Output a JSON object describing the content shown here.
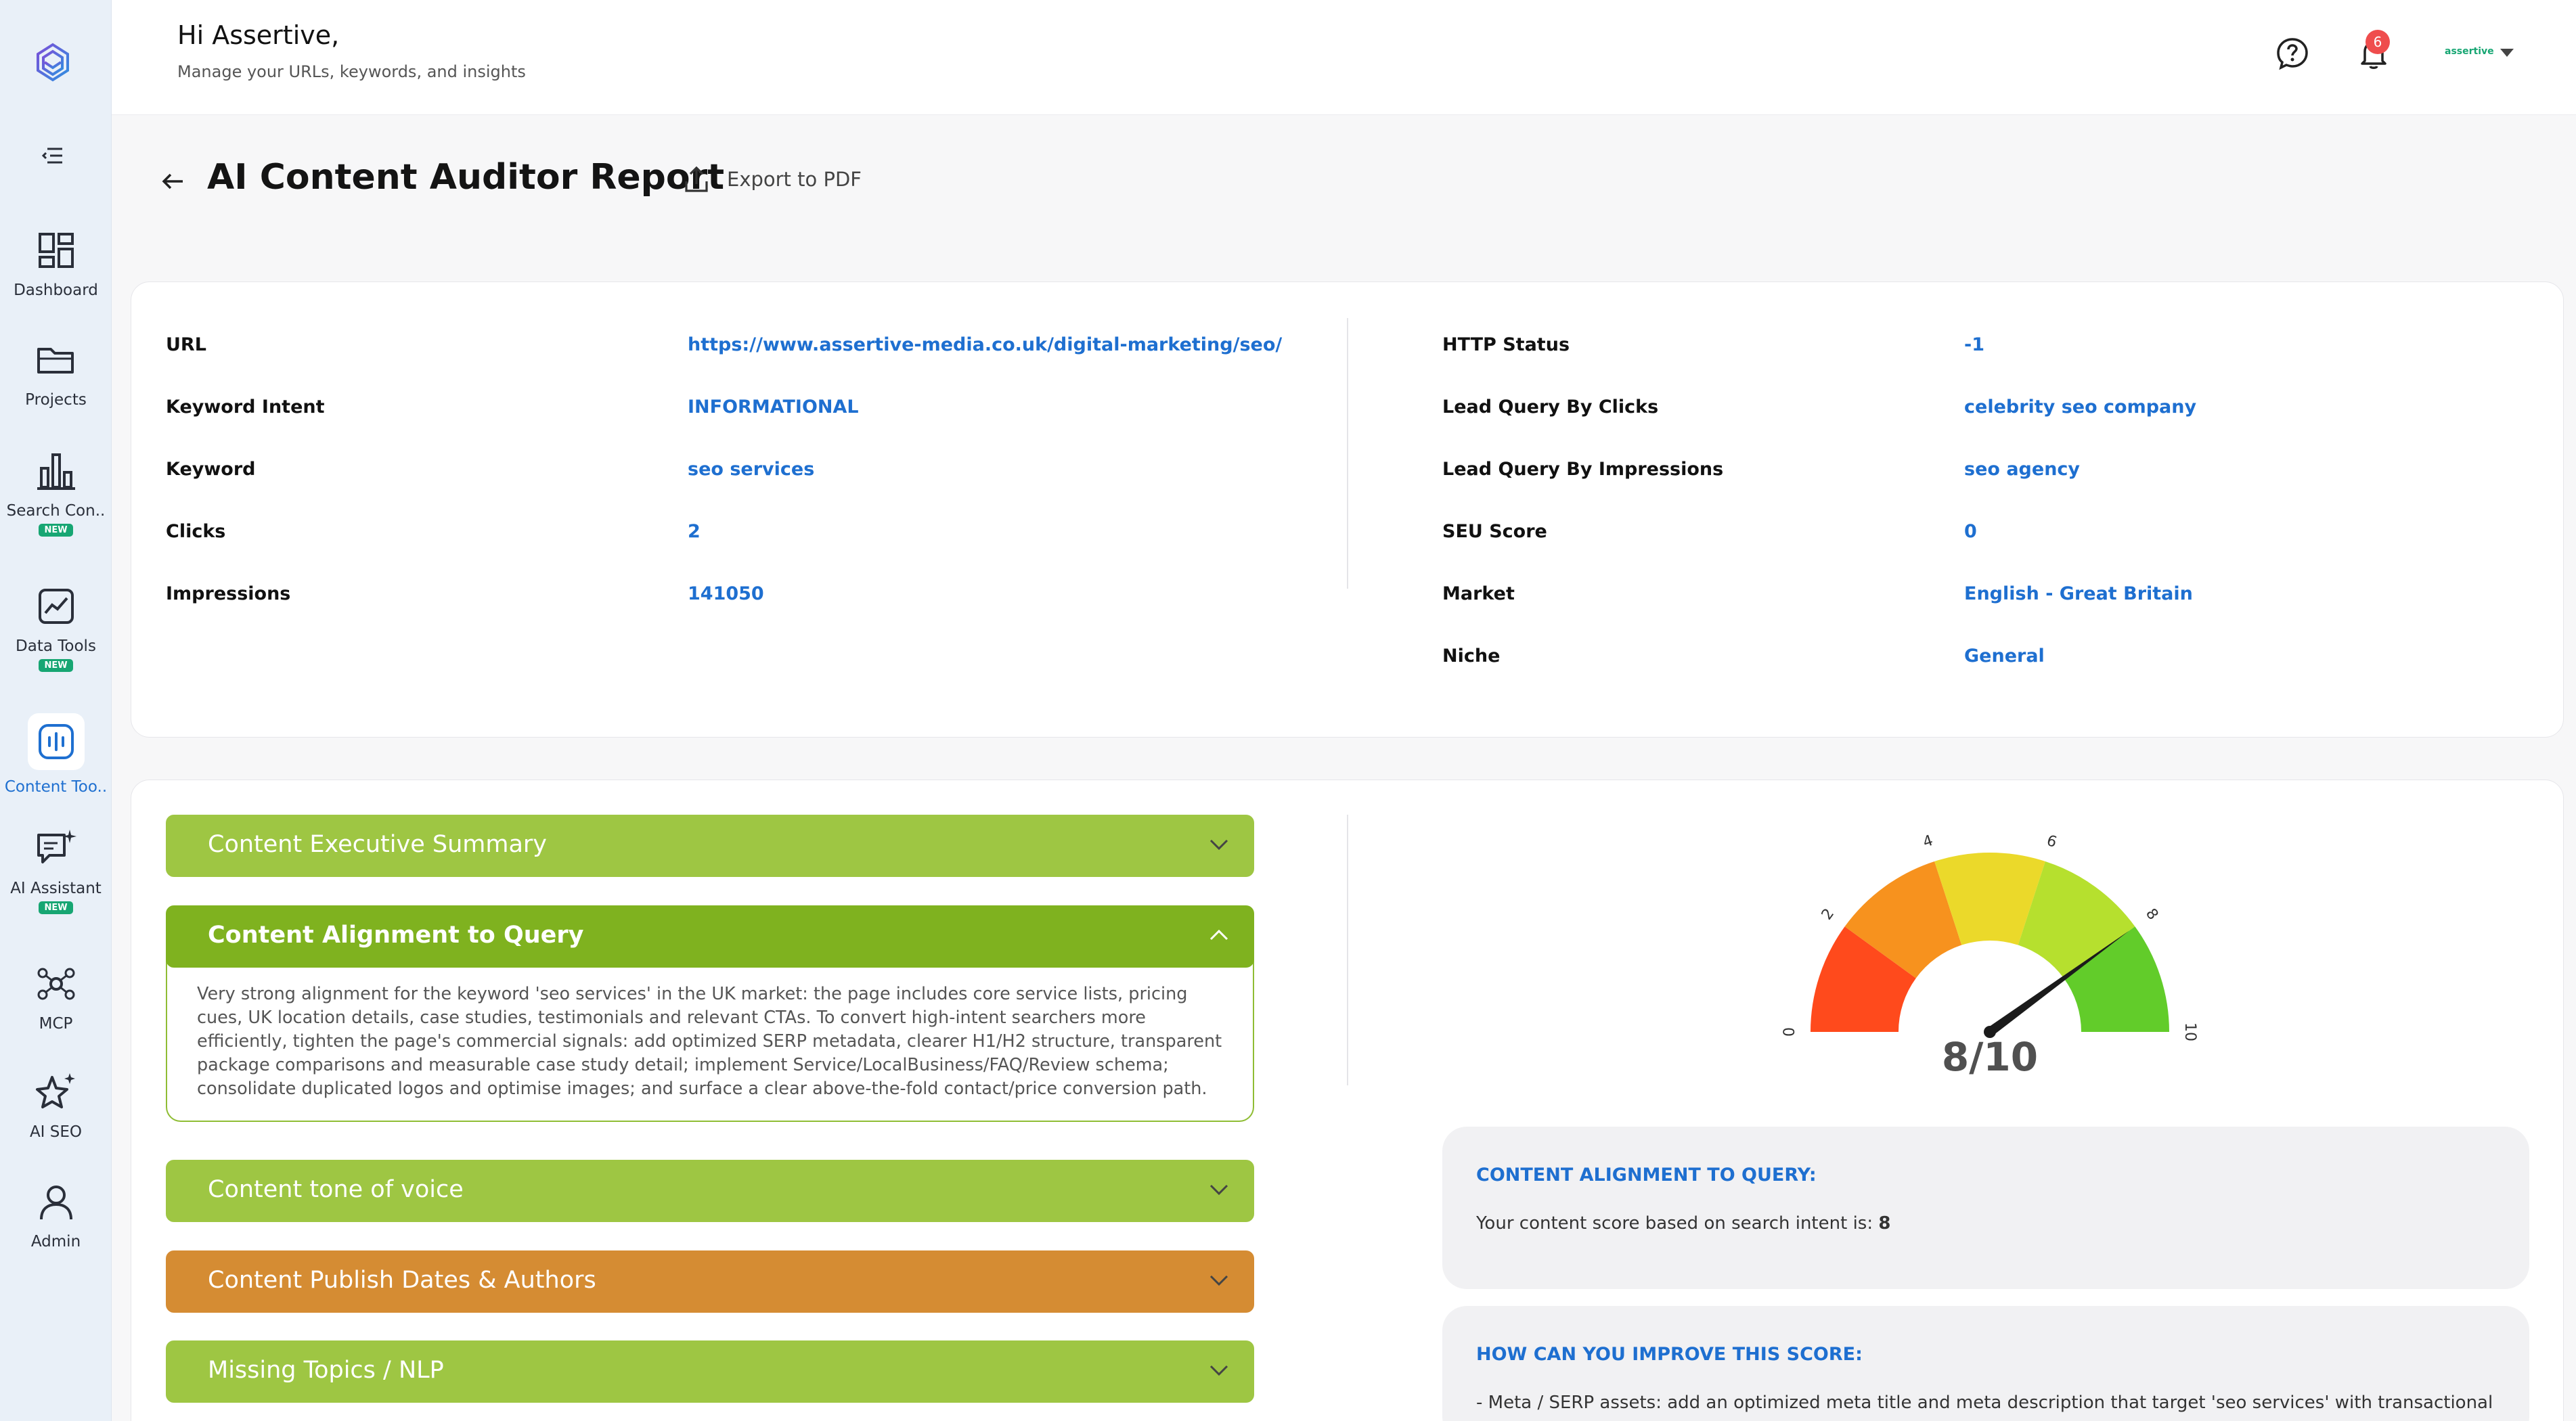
{
  "header": {
    "greeting": "Hi Assertive,",
    "subtitle": "Manage your URLs, keywords, and insights",
    "notification_count": "6",
    "account_name": "assertive"
  },
  "sidebar": {
    "items": [
      {
        "label": "Dashboard",
        "icon": "dashboard-icon",
        "new": false,
        "active": false
      },
      {
        "label": "Projects",
        "icon": "folder-icon",
        "new": false,
        "active": false
      },
      {
        "label": "Search Con..",
        "icon": "bar-chart-icon",
        "new": true,
        "active": false
      },
      {
        "label": "Data Tools",
        "icon": "trend-chart-icon",
        "new": true,
        "active": false
      },
      {
        "label": "Content Too..",
        "icon": "audio-bars-icon",
        "new": false,
        "active": true
      },
      {
        "label": "AI Assistant",
        "icon": "chat-sparkle-icon",
        "new": true,
        "active": false
      },
      {
        "label": "MCP",
        "icon": "network-icon",
        "new": false,
        "active": false
      },
      {
        "label": "AI SEO",
        "icon": "sparkle-star-icon",
        "new": false,
        "active": false
      },
      {
        "label": "Admin",
        "icon": "user-icon",
        "new": false,
        "active": false
      }
    ],
    "new_badge": "NEW"
  },
  "page": {
    "title": "AI Content Auditor Report",
    "export_label": "Export to PDF"
  },
  "info": {
    "left": [
      {
        "label": "URL",
        "value": "https://www.assertive-media.co.uk/digital-marketing/seo/"
      },
      {
        "label": "Keyword Intent",
        "value": "INFORMATIONAL"
      },
      {
        "label": "Keyword",
        "value": "seo services"
      },
      {
        "label": "Clicks",
        "value": "2"
      },
      {
        "label": "Impressions",
        "value": "141050"
      }
    ],
    "right": [
      {
        "label": "HTTP Status",
        "value": "-1"
      },
      {
        "label": "Lead Query By Clicks",
        "value": "celebrity seo company"
      },
      {
        "label": "Lead Query By Impressions",
        "value": "seo agency"
      },
      {
        "label": "SEU Score",
        "value": "0"
      },
      {
        "label": "Market",
        "value": "English - Great Britain"
      },
      {
        "label": "Niche",
        "value": "General"
      }
    ]
  },
  "accordions": [
    {
      "title": "Content Executive Summary",
      "open": false,
      "color": "#9ec643"
    },
    {
      "title": "Content Alignment to Query",
      "open": true,
      "color": "#7fb21f",
      "body": "Very strong alignment for the keyword 'seo services' in the UK market: the page includes core service lists, pricing cues, UK location details, case studies, testimonials and relevant CTAs. To convert high-intent searchers more efficiently, tighten the page's commercial signals: add optimized SERP metadata, clearer H1/H2 structure, transparent package comparisons and measurable case study detail; implement Service/LocalBusiness/FAQ/Review schema; consolidate duplicated logos and optimise images; and surface a clear above-the-fold contact/price conversion path."
    },
    {
      "title": "Content tone of voice",
      "open": false,
      "color": "#9ec643"
    },
    {
      "title": "Content Publish Dates & Authors",
      "open": false,
      "color": "#d58c33"
    },
    {
      "title": "Missing Topics / NLP",
      "open": false,
      "color": "#9ec643"
    }
  ],
  "gauge": {
    "score": 8,
    "max": 10,
    "score_label": "8/10",
    "tick_labels": [
      "0",
      "2",
      "4",
      "6",
      "8",
      "10"
    ],
    "segment_colors": [
      "#ff4a1c",
      "#f7921e",
      "#ebd92a",
      "#b6e02e",
      "#62cc2a"
    ]
  },
  "panels": {
    "alignment_heading": "CONTENT ALIGNMENT TO QUERY:",
    "alignment_text": "Your content score based on search intent is:",
    "alignment_score": "8",
    "improve_heading": "HOW CAN YOU IMPROVE THIS SCORE:",
    "improve_text": "- Meta / SERP assets: add an optimized meta title and meta description that target 'seo services' with transactional"
  }
}
